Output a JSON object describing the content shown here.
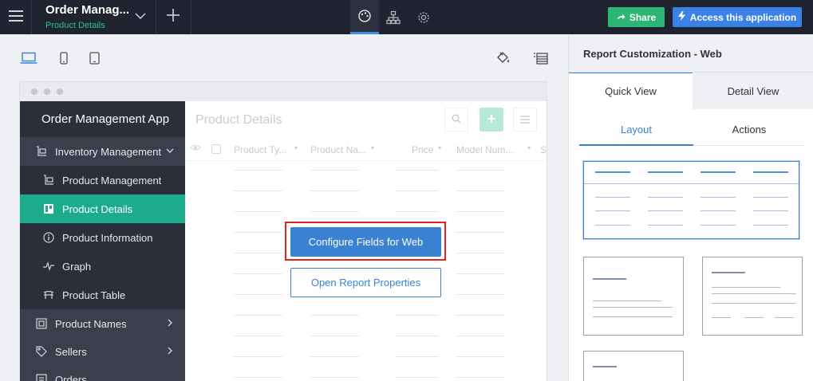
{
  "topbar": {
    "app_title": "Order Manag...",
    "app_subtitle": "Product Details",
    "share_label": "Share",
    "access_label": "Access this application"
  },
  "frame": {
    "sidebar": {
      "title": "Order Management App",
      "items": [
        {
          "label": "Inventory Management",
          "icon": "cart-icon"
        },
        {
          "label": "Product Management",
          "icon": "cart-icon"
        },
        {
          "label": "Product Details",
          "icon": "kanban-icon"
        },
        {
          "label": "Product Information",
          "icon": "info-icon"
        },
        {
          "label": "Graph",
          "icon": "pulse-icon"
        },
        {
          "label": "Product Table",
          "icon": "table-icon"
        },
        {
          "label": "Product Names",
          "icon": "box-icon"
        },
        {
          "label": "Sellers",
          "icon": "tag-icon"
        },
        {
          "label": "Orders",
          "icon": "list-icon"
        }
      ]
    },
    "report": {
      "title": "Product Details",
      "columns": [
        "Product Ty...",
        "Product Na...",
        "Price",
        "Model Num...",
        "S"
      ],
      "configure_label": "Configure Fields for Web",
      "properties_label": "Open Report Properties"
    }
  },
  "panel": {
    "title": "Report Customization - Web",
    "tabs": [
      "Quick View",
      "Detail View"
    ],
    "subtabs": [
      "Layout",
      "Actions"
    ]
  },
  "colors": {
    "accent": "#3a82d1",
    "share": "#2bb673",
    "access": "#3b82e6",
    "sidebar_active": "#1eaa8c",
    "highlight": "#e02424"
  }
}
